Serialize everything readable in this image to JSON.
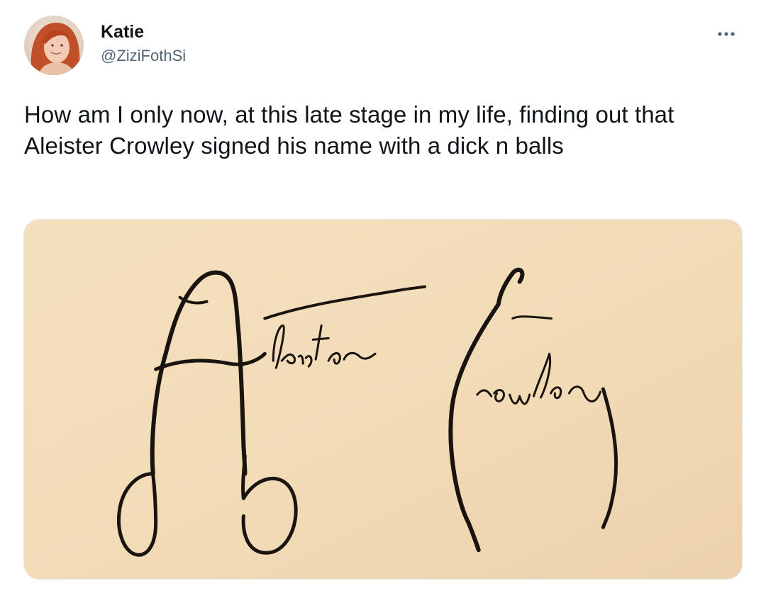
{
  "tweet": {
    "author": {
      "display_name": "Katie",
      "handle": "@ZiziFothSi",
      "avatar_icon": "profile-photo-avatar"
    },
    "more_icon": "more-horizontal-icon",
    "text": "How am I only now, at this late stage in my life, finding out that Aleister Crowley signed his name with a dick n balls",
    "media": {
      "kind": "handwritten-signature-image",
      "signature_text": "Aleister Crowley",
      "paper_color": "#f3dcb8",
      "ink_color": "#1a1410"
    }
  }
}
